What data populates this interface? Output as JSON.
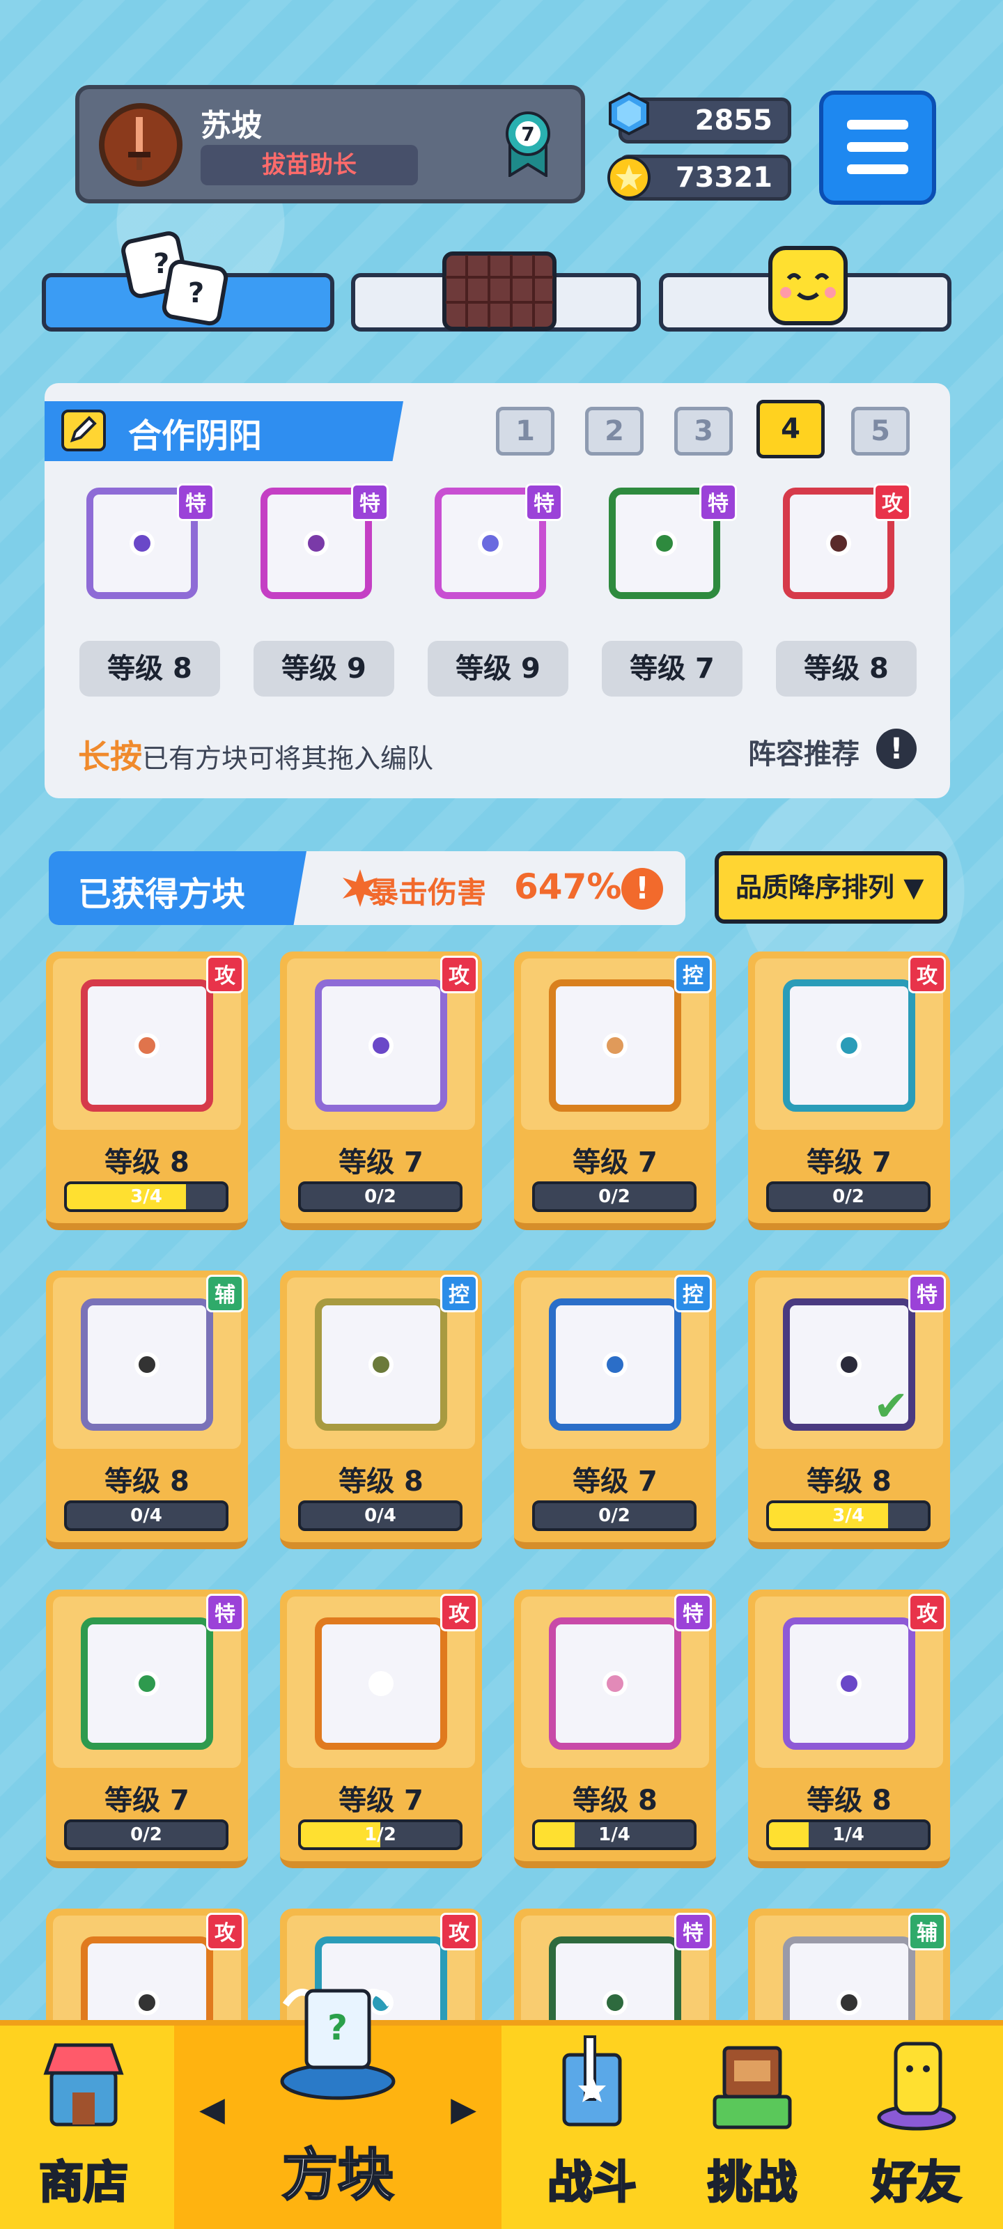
{
  "player": {
    "name": "苏坡",
    "title": "拔苗助长",
    "rank": "7"
  },
  "currency": {
    "gems": "2855",
    "coins": "73321"
  },
  "colors": {
    "attack": "#e8334a",
    "control": "#2b8de8",
    "special": "#9b42d8",
    "support": "#2faa6a"
  },
  "panel": {
    "title": "合作阴阳",
    "team_tabs": [
      "1",
      "2",
      "3",
      "4",
      "5"
    ],
    "active_team": "4",
    "slots": [
      {
        "badge": "特",
        "level": "等级 8",
        "color": "#8e6bd6",
        "dot": "#6a48c8"
      },
      {
        "badge": "特",
        "level": "等级 9",
        "color": "#c43fc4",
        "dot": "#7a3aa8"
      },
      {
        "badge": "特",
        "level": "等级 9",
        "color": "#c84fd2",
        "dot": "#6a6adf"
      },
      {
        "badge": "特",
        "level": "等级 7",
        "color": "#2e8a3e",
        "dot": "#2e8a3e"
      },
      {
        "badge": "攻",
        "level": "等级 8",
        "color": "#d63a4a",
        "dot": "#5a2a2a"
      }
    ],
    "hint_key": "长按",
    "hint_text": "已有方块可将其拖入编队",
    "recommend": "阵容推荐",
    "recommend_icon": "!"
  },
  "owned": {
    "title": "已获得方块",
    "crit_label": "暴击伤害",
    "crit_value": "647%",
    "crit_icon": "!",
    "sort_label": "品质降序排列 ▼",
    "cards": [
      {
        "badge": "攻",
        "level": "等级 8",
        "progress": "3/4",
        "fill": 0.75,
        "color": "#d63a4a",
        "dot": "#e0744c"
      },
      {
        "badge": "攻",
        "level": "等级 7",
        "progress": "0/2",
        "fill": 0,
        "color": "#8e6bd6",
        "dot": "#6a48c8"
      },
      {
        "badge": "控",
        "level": "等级 7",
        "progress": "0/2",
        "fill": 0,
        "color": "#d9801e",
        "dot": "#e09a5a"
      },
      {
        "badge": "攻",
        "level": "等级 7",
        "progress": "0/2",
        "fill": 0,
        "color": "#2a9cb8",
        "dot": "#2a9cb8"
      },
      {
        "badge": "辅",
        "level": "等级 8",
        "progress": "0/4",
        "fill": 0,
        "color": "#7a72b8",
        "dot": "#333333"
      },
      {
        "badge": "控",
        "level": "等级 8",
        "progress": "0/4",
        "fill": 0,
        "color": "#a89a40",
        "dot": "#6b7a3a"
      },
      {
        "badge": "控",
        "level": "等级 7",
        "progress": "0/2",
        "fill": 0,
        "color": "#2b6ec8",
        "dot": "#2b6ec8"
      },
      {
        "badge": "特",
        "level": "等级 8",
        "progress": "3/4",
        "fill": 0.75,
        "color": "#4a3a80",
        "dot": "#2a2a3a",
        "checked": true
      },
      {
        "badge": "特",
        "level": "等级 7",
        "progress": "0/2",
        "fill": 0,
        "color": "#2e9a4e",
        "dot": "#2e9a4e"
      },
      {
        "badge": "攻",
        "level": "等级 7",
        "progress": "1/2",
        "fill": 0.5,
        "color": "#e07a1e",
        "dot": "#ffffff"
      },
      {
        "badge": "特",
        "level": "等级 8",
        "progress": "1/4",
        "fill": 0.25,
        "color": "#c84aa8",
        "dot": "#e28ab8"
      },
      {
        "badge": "攻",
        "level": "等级 8",
        "progress": "1/4",
        "fill": 0.25,
        "color": "#8e5ad6",
        "dot": "#6a48c8"
      },
      {
        "badge": "攻",
        "level": "",
        "progress": "",
        "fill": 0,
        "color": "#e07a1e",
        "dot": "#333333"
      },
      {
        "badge": "攻",
        "level": "",
        "progress": "",
        "fill": 0,
        "color": "#2a9cb8",
        "dot": "#2a9cb8"
      },
      {
        "badge": "特",
        "level": "",
        "progress": "",
        "fill": 0,
        "color": "#2e6a3e",
        "dot": "#2e6a3e"
      },
      {
        "badge": "辅",
        "level": "",
        "progress": "",
        "fill": 0,
        "color": "#9a9aa8",
        "dot": "#333333"
      }
    ]
  },
  "nav": {
    "shop": "商店",
    "blocks": "方块",
    "battle": "战斗",
    "challenge": "挑战",
    "friends": "好友",
    "blocks_left": "◀",
    "blocks_right": "▶"
  }
}
